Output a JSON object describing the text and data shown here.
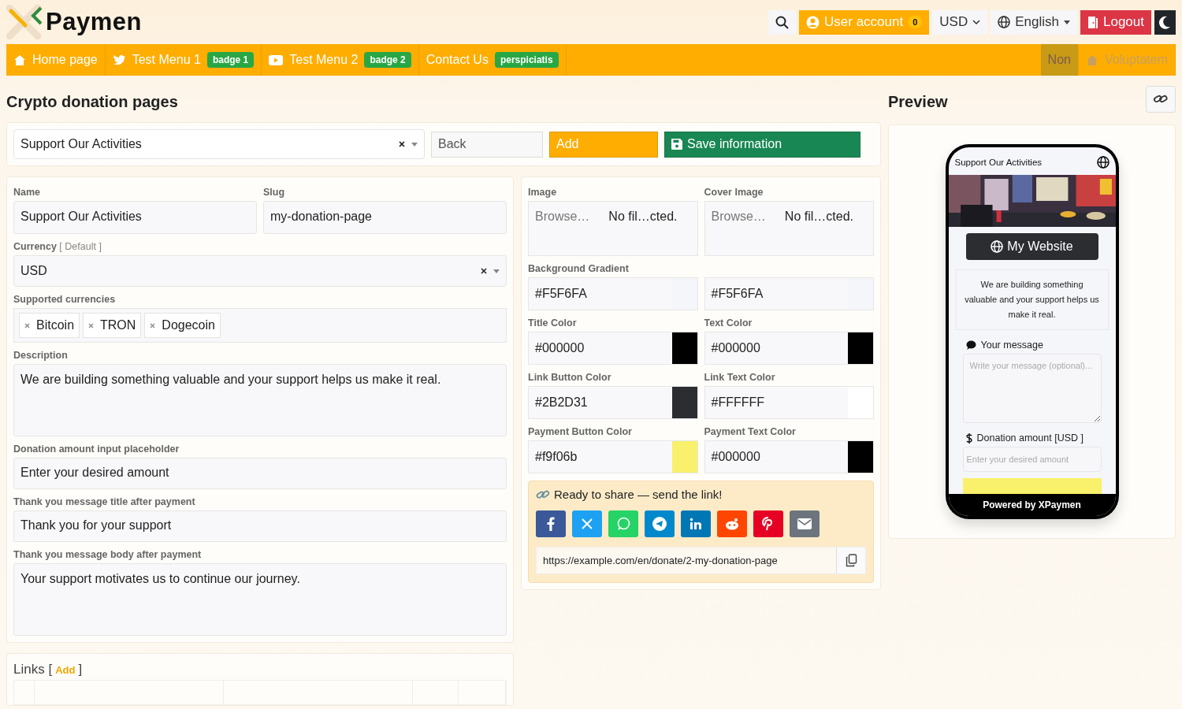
{
  "header": {
    "logo": "Paymen",
    "user_account": {
      "label": "User account",
      "count": "0"
    },
    "currency": "USD",
    "language": "English",
    "logout": "Logout"
  },
  "nav": {
    "items": [
      {
        "label": "Home page",
        "selected": false,
        "disabled": false
      },
      {
        "label": "Test Menu 1",
        "badge": "badge 1",
        "selected": false,
        "disabled": false
      },
      {
        "label": "Test Menu 2",
        "badge": "badge 2",
        "selected": false,
        "disabled": false
      },
      {
        "label": "Contact Us",
        "badge": "perspiciatis",
        "selected": false,
        "disabled": false
      }
    ],
    "right_items": [
      {
        "label": "Non",
        "selected": true,
        "disabled": false
      },
      {
        "label": "Voluptatem",
        "selected": false,
        "disabled": true
      }
    ]
  },
  "page_title": "Crypto donation pages",
  "preview_title": "Preview",
  "toolbar": {
    "page_select": "Support Our Activities",
    "back": "Back",
    "add": "Add",
    "save": "Save information"
  },
  "form": {
    "name": {
      "label": "Name",
      "value": "Support Our Activities"
    },
    "slug": {
      "label": "Slug",
      "value": "my-donation-page"
    },
    "currency": {
      "label": "Currency",
      "hint": "[ Default ]",
      "value": "USD"
    },
    "supported_currencies": {
      "label": "Supported currencies",
      "tags": [
        "Bitcoin",
        "TRON",
        "Dogecoin"
      ]
    },
    "description": {
      "label": "Description",
      "value": "We are building something valuable and your support helps us make it real."
    },
    "amount_placeholder": {
      "label": "Donation amount input placeholder",
      "value": "Enter your desired amount"
    },
    "thanks_title": {
      "label": "Thank you message title after payment",
      "value": "Thank you for your support"
    },
    "thanks_body": {
      "label": "Thank you message body after payment",
      "value": "Your support motivates us to continue our journey."
    }
  },
  "images": [
    {
      "label": "Image",
      "browse": "Browse…",
      "file": "No fil…cted."
    },
    {
      "label": "Cover Image",
      "browse": "Browse…",
      "file": "No fil…cted."
    }
  ],
  "background_gradient": {
    "label": "Background Gradient",
    "colors": [
      {
        "value": "#F5F6FA",
        "color": "#f5f6fa"
      },
      {
        "value": "#F5F6FA",
        "color": "#f5f6fa"
      }
    ]
  },
  "colors": [
    {
      "label": "Title Color",
      "value": "#000000",
      "color": "#000000"
    },
    {
      "label": "Text Color",
      "value": "#000000",
      "color": "#000000"
    },
    {
      "label": "Link Button Color",
      "value": "#2B2D31",
      "color": "#2b2d31"
    },
    {
      "label": "Link Text Color",
      "value": "#FFFFFF",
      "color": "#ffffff"
    },
    {
      "label": "Payment Button Color",
      "value": "#f9f06b",
      "color": "#f9f06b"
    },
    {
      "label": "Payment Text Color",
      "value": "#000000",
      "color": "#000000"
    }
  ],
  "share": {
    "title": "Ready to share — send the link!",
    "buttons": [
      {
        "kind": "facebook",
        "color": "#3b5998"
      },
      {
        "kind": "x",
        "color": "#1da1f2"
      },
      {
        "kind": "whatsapp",
        "color": "#25d366"
      },
      {
        "kind": "telegram",
        "color": "#0088cc"
      },
      {
        "kind": "linkedin",
        "color": "#0077b5"
      },
      {
        "kind": "reddit",
        "color": "#ff4500"
      },
      {
        "kind": "pinterest",
        "color": "#e60023"
      },
      {
        "kind": "email",
        "color": "#6c757d"
      }
    ],
    "url": "https://example.com/en/donate/2-my-donation-page"
  },
  "links": {
    "title": "Links [",
    "add": "Add",
    "close": "]"
  },
  "preview": {
    "title": "Support Our Activities",
    "website": "My Website",
    "description": "We are building something valuable and your support helps us make it real.",
    "message_label": "Your message",
    "message_placeholder": "Write your message (optional)...",
    "amount_label": "Donation amount [USD ]",
    "amount_placeholder": "Enter your desired amount",
    "footer": "Powered by XPaymen"
  }
}
